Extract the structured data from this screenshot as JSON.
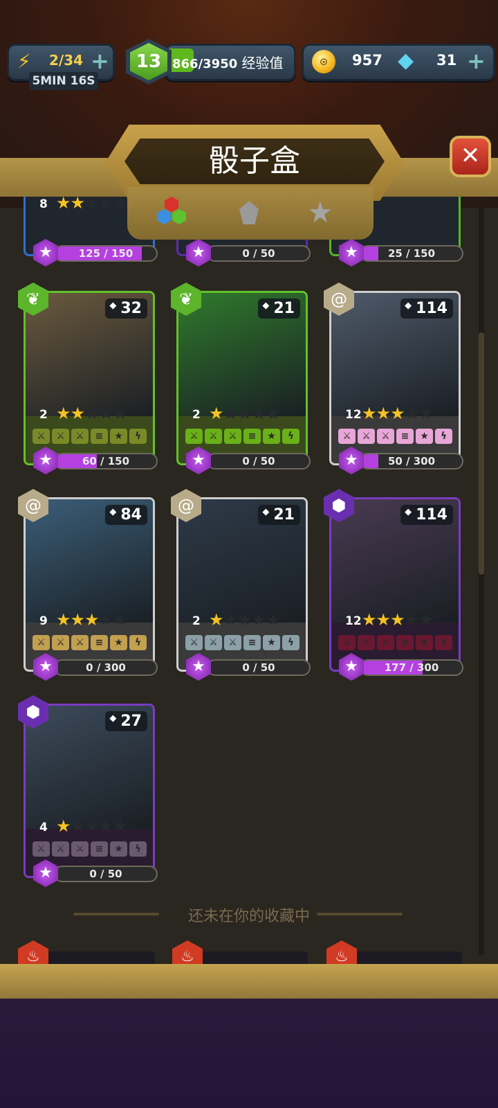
{
  "hud": {
    "energy": "2/34",
    "timer": "5MIN 16S",
    "level": "13",
    "xp": "866/3950",
    "xp_label": "经验值",
    "xp_progress": 0.219,
    "coins": "957",
    "gems": "31"
  },
  "header": {
    "title": "骰子盒",
    "close_icon": "close-icon"
  },
  "filters": [
    {
      "name": "element-filter",
      "icon": "cubes-icon"
    },
    {
      "name": "rarity-filter",
      "icon": "diamond-icon"
    },
    {
      "name": "stars-filter",
      "icon": "star-icon"
    }
  ],
  "partial_row": [
    {
      "level": "8",
      "stars": 2,
      "progress": "125 / 150",
      "progress_value": 0.833,
      "border": "#2f6fd0"
    },
    {
      "level": "",
      "stars": 0,
      "progress": "0 / 50",
      "progress_value": 0,
      "border": "#5b2ea8"
    },
    {
      "level": "",
      "stars": 0,
      "progress": "25 / 150",
      "progress_value": 0.167,
      "border": "#56b52a"
    }
  ],
  "cards": [
    {
      "element": "leaf-icon",
      "count": "32",
      "level": "2",
      "stars": 2,
      "progress": "60 / 150",
      "progress_value": 0.4,
      "border": "#63c12a",
      "art": "#6b5a3e",
      "strip": "#3a4a1c",
      "ab_bg": "#7a8a28"
    },
    {
      "element": "leaf-icon",
      "count": "21",
      "level": "2",
      "stars": 1,
      "progress": "0 / 50",
      "progress_value": 0,
      "border": "#63c12a",
      "art": "#2f7a2c",
      "strip": "#3a4a1c",
      "ab_bg": "#6ab018"
    },
    {
      "element": "spiral-icon",
      "count": "114",
      "level": "12",
      "stars": 3,
      "progress": "50 / 300",
      "progress_value": 0.167,
      "border": "#cfcfcf",
      "art": "#4f5a6a",
      "strip": "#3a3a3a",
      "ab_bg": "#e8a6d8"
    },
    {
      "element": "spiral-icon",
      "count": "84",
      "level": "9",
      "stars": 3,
      "progress": "0 / 300",
      "progress_value": 0,
      "border": "#cfcfcf",
      "art": "#3b5e78",
      "strip": "#3a3a3a",
      "ab_bg": "#c2a050"
    },
    {
      "element": "spiral-icon",
      "count": "21",
      "level": "2",
      "stars": 1,
      "progress": "0 / 50",
      "progress_value": 0,
      "border": "#cfcfcf",
      "art": "#2e3a48",
      "strip": "#3a3a3a",
      "ab_bg": "#8ca0a8"
    },
    {
      "element": "void-icon",
      "count": "114",
      "level": "12",
      "stars": 3,
      "progress": "177 / 300",
      "progress_value": 0.59,
      "border": "#7a3cc0",
      "art": "#4a3a52",
      "strip": "#2a1c30",
      "ab_bg": "#6a1830"
    },
    {
      "element": "void-icon",
      "count": "27",
      "level": "4",
      "stars": 1,
      "progress": "0 / 50",
      "progress_value": 0,
      "border": "#7a3cc0",
      "art": "#3c4a5a",
      "strip": "#2a1c30",
      "ab_bg": "#6a5a70"
    }
  ],
  "section_label": "还未在你的收藏中"
}
